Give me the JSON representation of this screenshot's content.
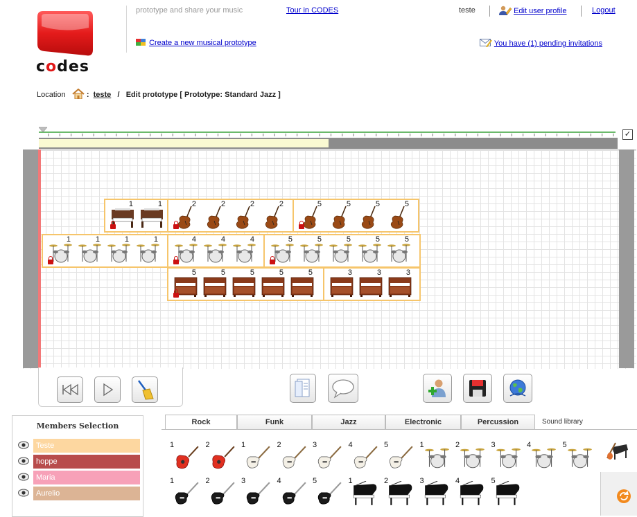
{
  "header": {
    "logo_text_pre": "c",
    "logo_text_hl": "o",
    "logo_text_post": "des",
    "tagline": "prototype and share your music",
    "tour_link": "Tour in CODES",
    "create_link": "Create a new musical prototype",
    "user_name": "teste",
    "edit_profile": "Edit user profile",
    "logout": "Logout",
    "invitations": "You have (1) pending invitations"
  },
  "location": {
    "label": "Location",
    "colon": ":",
    "user_link": "teste",
    "slash": "/",
    "current": "Edit prototype [ Prototype: Standard Jazz ]"
  },
  "timeline": {
    "scroll_fraction": 0.5,
    "loop_checked": true,
    "check_mark": "✓"
  },
  "tracks": {
    "organ_block": {
      "cells": [
        {
          "num": "1",
          "lock": true
        },
        {
          "num": "1",
          "lock": false
        }
      ]
    },
    "bass_block_a": {
      "cells": [
        {
          "num": "2",
          "lock": true
        },
        {
          "num": "2",
          "lock": false
        },
        {
          "num": "2",
          "lock": false
        },
        {
          "num": "2",
          "lock": false
        }
      ]
    },
    "bass_block_b": {
      "cells": [
        {
          "num": "5",
          "lock": true
        },
        {
          "num": "5",
          "lock": false
        },
        {
          "num": "5",
          "lock": false
        },
        {
          "num": "5",
          "lock": false
        }
      ]
    },
    "drum_block_a": {
      "cells": [
        {
          "num": "1",
          "lock": true
        },
        {
          "num": "1",
          "lock": false
        },
        {
          "num": "1",
          "lock": false
        },
        {
          "num": "1",
          "lock": false
        }
      ]
    },
    "drum_block_b": {
      "cells": [
        {
          "num": "4",
          "lock": true
        },
        {
          "num": "4",
          "lock": false
        },
        {
          "num": "4",
          "lock": false
        }
      ]
    },
    "drum_block_c": {
      "cells": [
        {
          "num": "5",
          "lock": true
        },
        {
          "num": "5",
          "lock": false
        },
        {
          "num": "5",
          "lock": false
        },
        {
          "num": "5",
          "lock": false
        },
        {
          "num": "5",
          "lock": false
        }
      ]
    },
    "piano_block_a": {
      "cells": [
        {
          "num": "5",
          "lock": true
        },
        {
          "num": "5",
          "lock": false
        },
        {
          "num": "5",
          "lock": false
        },
        {
          "num": "5",
          "lock": false
        },
        {
          "num": "5",
          "lock": false
        }
      ]
    },
    "piano_block_b": {
      "cells": [
        {
          "num": "3",
          "lock": false
        },
        {
          "num": "3",
          "lock": false
        },
        {
          "num": "3",
          "lock": false
        }
      ]
    }
  },
  "members": {
    "title": "Members Selection",
    "list": [
      {
        "name": "Teste",
        "color": "#fdd7a0"
      },
      {
        "name": "hoppe",
        "color": "#b84c4c"
      },
      {
        "name": "Maria",
        "color": "#f7a1b8"
      },
      {
        "name": "Aurelio",
        "color": "#dcb495"
      }
    ]
  },
  "library": {
    "tabs": [
      "Rock",
      "Funk",
      "Jazz",
      "Electronic",
      "Percussion"
    ],
    "active_tab": "Rock",
    "sound_library": "Sound library",
    "row1": [
      {
        "num": "1",
        "kind": "red-guitar"
      },
      {
        "num": "2",
        "kind": "red-guitar"
      },
      {
        "num": "1",
        "kind": "white-guitar"
      },
      {
        "num": "2",
        "kind": "white-guitar"
      },
      {
        "num": "3",
        "kind": "white-guitar"
      },
      {
        "num": "4",
        "kind": "white-guitar"
      },
      {
        "num": "5",
        "kind": "white-guitar"
      },
      {
        "num": "1",
        "kind": "drums"
      },
      {
        "num": "2",
        "kind": "drums"
      },
      {
        "num": "3",
        "kind": "drums"
      },
      {
        "num": "4",
        "kind": "drums"
      },
      {
        "num": "5",
        "kind": "drums"
      }
    ],
    "row2": [
      {
        "num": "1",
        "kind": "black-guitar"
      },
      {
        "num": "2",
        "kind": "black-guitar"
      },
      {
        "num": "3",
        "kind": "black-guitar"
      },
      {
        "num": "4",
        "kind": "black-guitar"
      },
      {
        "num": "5",
        "kind": "black-guitar"
      },
      {
        "num": "1",
        "kind": "grand-piano"
      },
      {
        "num": "2",
        "kind": "grand-piano"
      },
      {
        "num": "3",
        "kind": "grand-piano"
      },
      {
        "num": "4",
        "kind": "grand-piano"
      },
      {
        "num": "5",
        "kind": "grand-piano"
      }
    ]
  },
  "colors": {
    "accent": "#e01818",
    "block_border": "#f6c56b",
    "playhead": "#f27878",
    "rail": "#9a9a9a"
  }
}
